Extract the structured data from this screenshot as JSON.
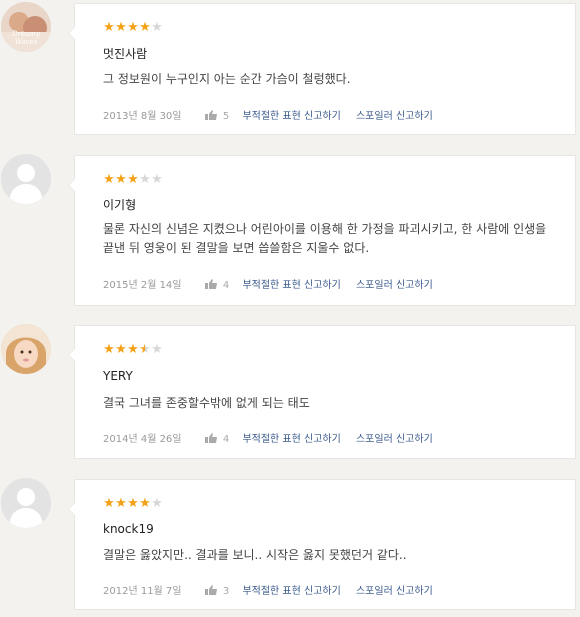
{
  "reviews": [
    {
      "avatar": "photo-avatar",
      "stars": [
        1,
        1,
        1,
        1,
        0
      ],
      "author": "멋진사람",
      "body": "그 정보원이 누구인지 아는 순간 가슴이 철렁했다.",
      "date": "2013년 8월 30일",
      "likes": "5",
      "report_label": "부적절한 표현 신고하기",
      "spoiler_label": "스포일러 신고하기"
    },
    {
      "avatar": "default-avatar",
      "stars": [
        1,
        1,
        1,
        0,
        0
      ],
      "author": "이기형",
      "body": "물론 자신의 신념은 지켰으나 어린아이를 이용해 한 가정을 파괴시키고, 한 사람에 인생을 끝낸 뒤 영웅이 된 결말을 보면 씁쓸함은 지울수 없다.",
      "date": "2015년 2월 14일",
      "likes": "4",
      "report_label": "부적절한 표현 신고하기",
      "spoiler_label": "스포일러 신고하기"
    },
    {
      "avatar": "photo-avatar",
      "stars": [
        1,
        1,
        1,
        0.5,
        0
      ],
      "author": "YERY",
      "body": "결국 그녀를 존중할수밖에 없게 되는 태도",
      "date": "2014년 4월 26일",
      "likes": "4",
      "report_label": "부적절한 표현 신고하기",
      "spoiler_label": "스포일러 신고하기"
    },
    {
      "avatar": "default-avatar",
      "stars": [
        1,
        1,
        1,
        1,
        0
      ],
      "author": "knock19",
      "body": "결말은 옳았지만.. 결과를 보니.. 시작은 옳지 못했던거 같다..",
      "date": "2012년 11월 7일",
      "likes": "3",
      "report_label": "부적절한 표현 신고하기",
      "spoiler_label": "스포일러 신고하기"
    }
  ],
  "avatar_text": "Dreamy Waves",
  "colors": {
    "star_on": "#f3a117",
    "star_off": "#d7d7d7",
    "link": "#3a5a8c"
  }
}
